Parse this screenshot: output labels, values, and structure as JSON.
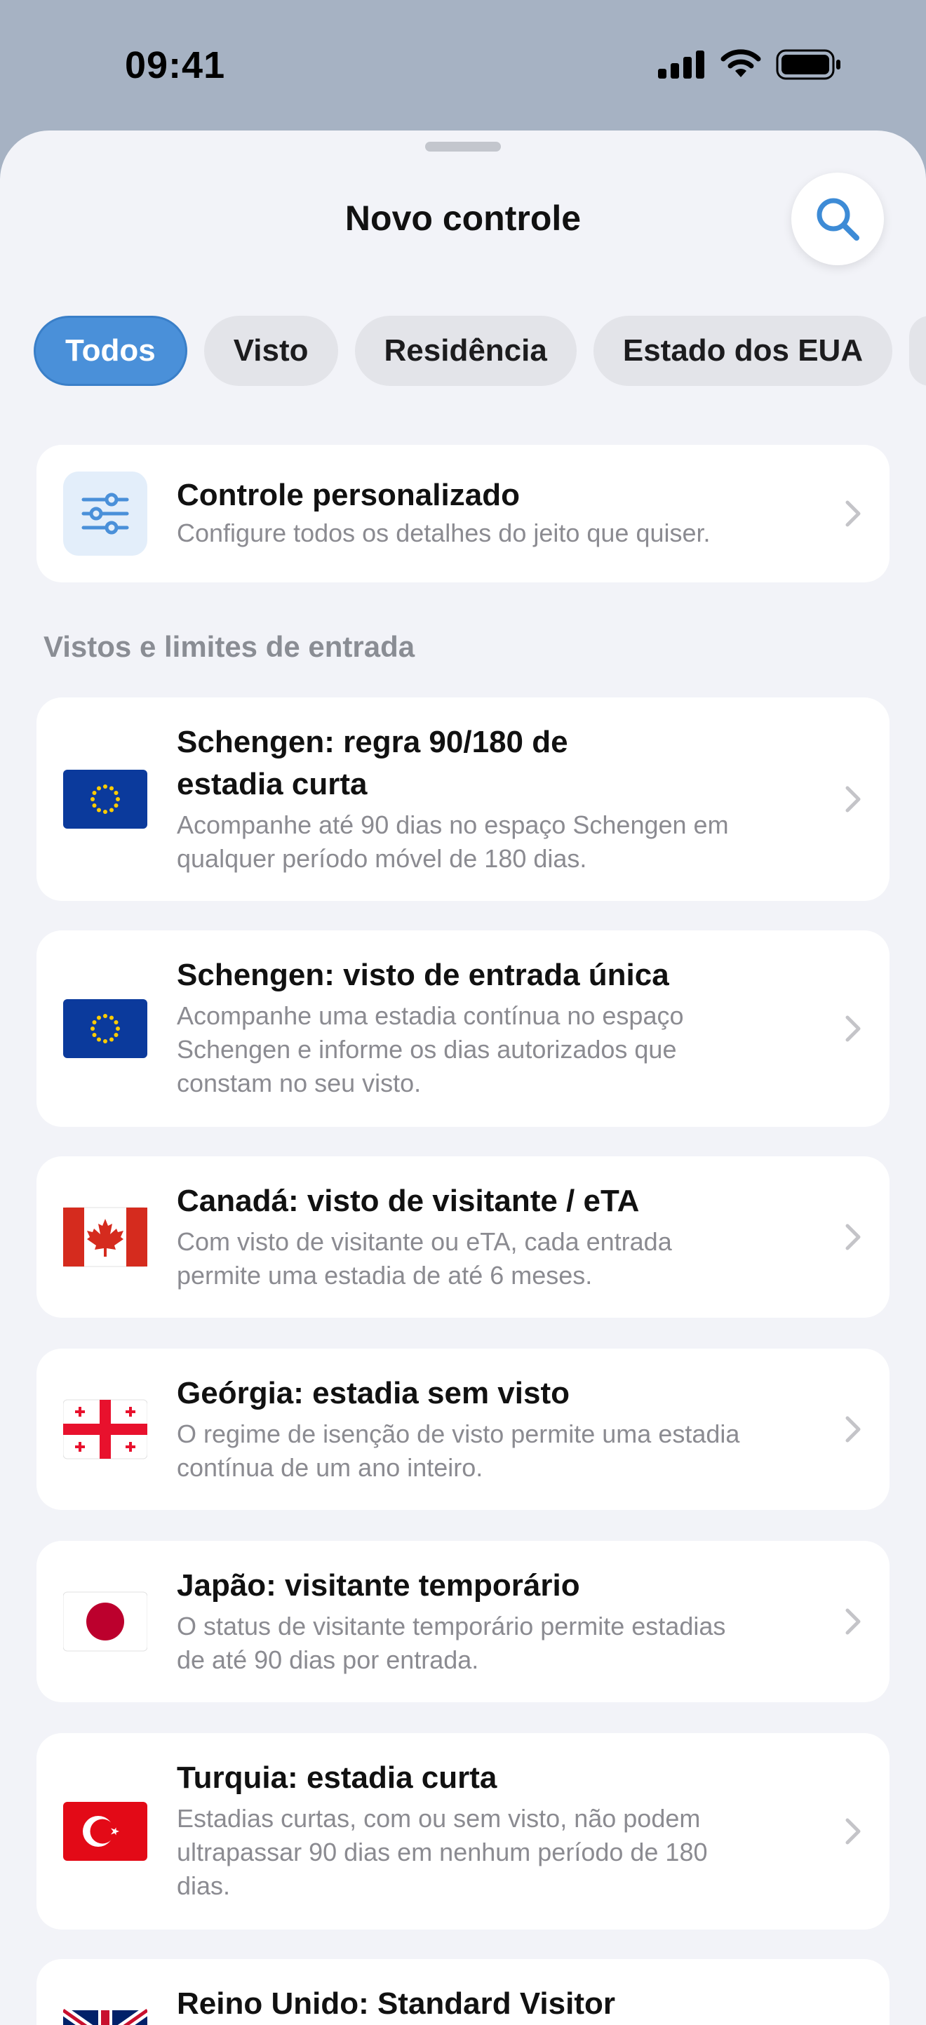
{
  "status": {
    "time": "09:41"
  },
  "header": {
    "title": "Novo controle"
  },
  "tabs": [
    "Todos",
    "Visto",
    "Residência",
    "Estado dos EUA"
  ],
  "custom": {
    "title": "Controle personalizado",
    "subtitle": "Configure todos os detalhes do jeito que quiser."
  },
  "section": {
    "label": "Vistos e limites de entrada"
  },
  "items": [
    {
      "title_line1": "Schengen: regra 90/180 de",
      "title_line2": "estadia curta",
      "sub_line1": "Acompanhe até 90 dias no espaço Schengen em",
      "sub_line2": "qualquer período móvel de 180 dias.",
      "flag": "eu-flag"
    },
    {
      "title_line1": "Schengen: visto de entrada única",
      "sub_line1": "Acompanhe uma estadia contínua no espaço",
      "sub_line2": "Schengen e informe os dias autorizados que",
      "sub_line3": "constam no seu visto.",
      "flag": "eu-flag"
    },
    {
      "title_line1": "Canadá: visto de visitante / eTA",
      "sub_line1": "Com visto de visitante ou eTA, cada entrada",
      "sub_line2": "permite uma estadia de até 6 meses.",
      "flag": "canada-flag"
    },
    {
      "title_line1": "Geórgia: estadia sem visto",
      "sub_line1": "O regime de isenção de visto permite uma estadia",
      "sub_line2": "contínua de um ano inteiro.",
      "flag": "georgia-flag"
    },
    {
      "title_line1": "Japão: visitante temporário",
      "sub_line1": "O status de visitante temporário permite estadias",
      "sub_line2": "de até 90 dias por entrada.",
      "flag": "japan-flag"
    },
    {
      "title_line1": "Turquia: estadia curta",
      "sub_line1": "Estadias curtas, com ou sem visto, não podem",
      "sub_line2": "ultrapassar 90 dias em nenhum período de 180",
      "sub_line3": "dias.",
      "flag": "turkey-flag"
    },
    {
      "title_line1": "Reino Unido: Standard Visitor",
      "flag": "uk-flag"
    }
  ],
  "colors": {
    "accent": "#4a90d9",
    "sheet_bg": "#f2f3f8",
    "backdrop": "#a6b2c3"
  }
}
